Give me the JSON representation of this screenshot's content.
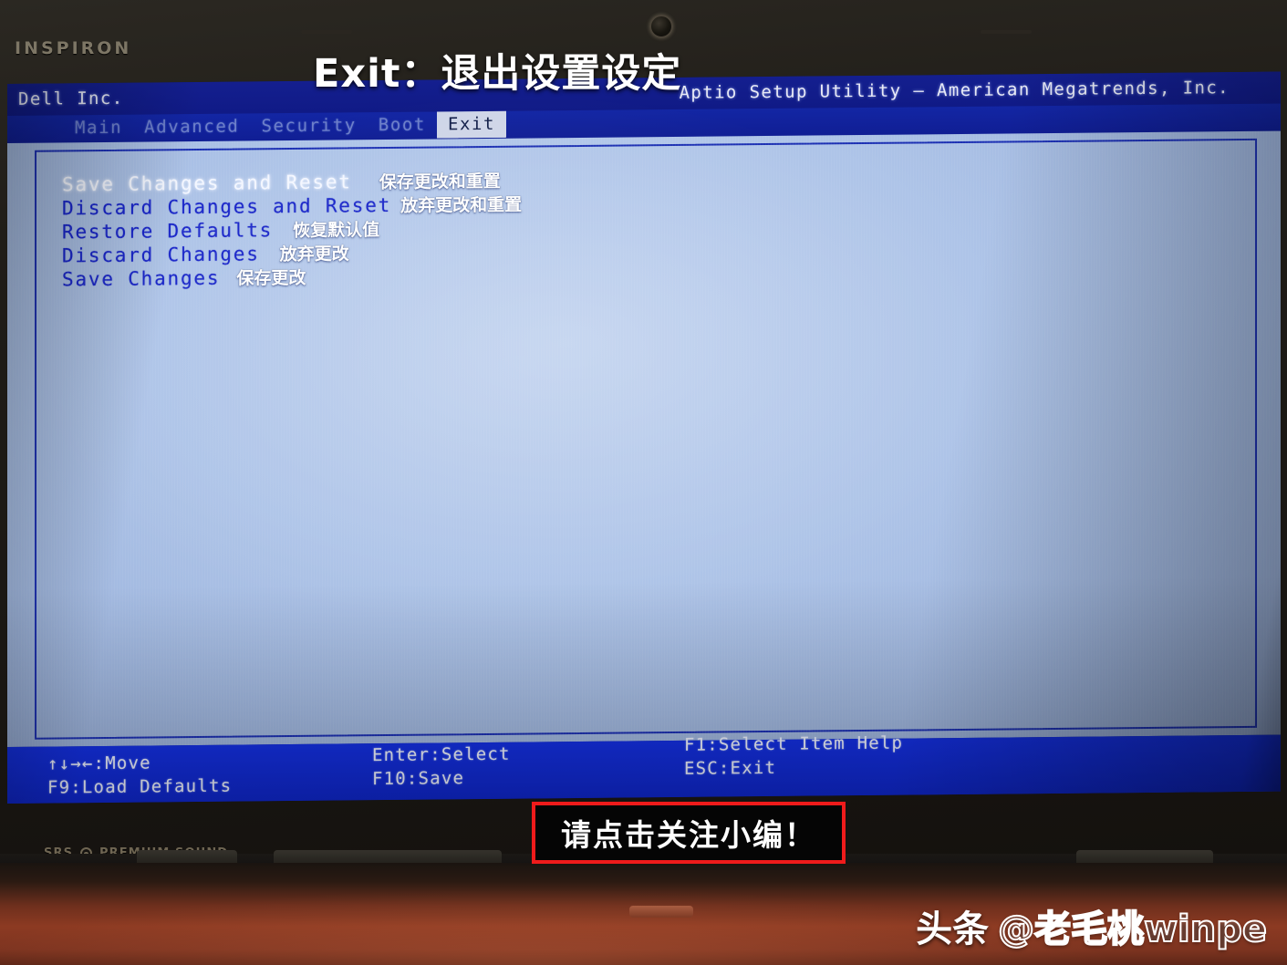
{
  "overlay": {
    "title": "Exit：退出设置设定",
    "callout": "请点击关注小编！",
    "watermark_brand": "头条",
    "watermark_handle": "@老毛桃winpe"
  },
  "laptop": {
    "bezel_brand": "INSPIRON",
    "audio_logo": "PREMIUM SOUND",
    "audio_logo_prefix": "SRS"
  },
  "bios": {
    "vendor": "Dell Inc.",
    "utility": "Aptio Setup Utility – American Megatrends, Inc.",
    "tabs": [
      {
        "label": "Main",
        "active": false
      },
      {
        "label": "Advanced",
        "active": false
      },
      {
        "label": "Security",
        "active": false
      },
      {
        "label": "Boot",
        "active": false
      },
      {
        "label": "Exit",
        "active": true
      }
    ],
    "menu_items": [
      {
        "label": "Save Changes and Reset",
        "note": "保存更改和重置",
        "selected": true
      },
      {
        "label": "Discard Changes and Reset",
        "note": "放弃更改和重置",
        "selected": false
      },
      {
        "label": "Restore Defaults",
        "note": "恢复默认值",
        "selected": false
      },
      {
        "label": "Discard Changes",
        "note": "放弃更改",
        "selected": false
      },
      {
        "label": "Save Changes",
        "note": "保存更改",
        "selected": false
      }
    ],
    "help": {
      "col1_line1": "↑↓→←:Move",
      "col1_line2": "F9:Load Defaults",
      "col2_line1": "Enter:Select",
      "col2_line2": "F10:Save",
      "col3_line1": "F1:Select Item Help",
      "col3_line2": "ESC:Exit"
    }
  },
  "colors": {
    "header_blue": "#101a86",
    "tab_bar_blue": "#101e94",
    "body_blue": "#aec4e8",
    "help_bar_blue": "#0f27cf",
    "menu_text_blue": "#1724c9",
    "callout_red": "#ef1b1b"
  }
}
